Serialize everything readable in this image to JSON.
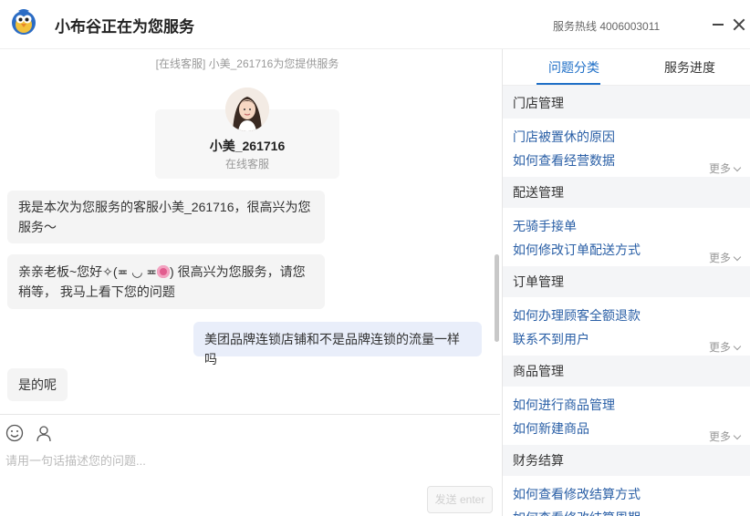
{
  "header": {
    "title": "小布谷正在为您服务",
    "hotline": "服务热线 4006003011"
  },
  "chat": {
    "system_line": "[在线客服] 小美_261716为您提供服务",
    "agent": {
      "name": "小美_261716",
      "role": "在线客服"
    },
    "messages": [
      {
        "from": "agent",
        "line1": "我是本次为您服务的客服小美_261716，很高兴为您",
        "line2": "服务～"
      },
      {
        "from": "agent",
        "line1_pre": "亲亲老板~您好✧(≖ ◡ ≖",
        "line1_post": ") 很高兴为您服务，请您",
        "line2": "稍等， 我马上看下您的问题"
      },
      {
        "from": "user",
        "text": "美团品牌连锁店铺和不是品牌连锁的流量一样吗"
      },
      {
        "from": "agent",
        "text": "是的呢"
      }
    ]
  },
  "input": {
    "placeholder": "请用一句话描述您的问题...",
    "send_label": "发送 enter"
  },
  "sidebar": {
    "tabs": [
      {
        "label": "问题分类",
        "active": true
      },
      {
        "label": "服务进度",
        "active": false
      }
    ],
    "more_label": "更多",
    "sections": [
      {
        "title": "门店管理",
        "links": [
          "门店被置休的原因",
          "如何查看经营数据"
        ]
      },
      {
        "title": "配送管理",
        "links": [
          "无骑手接单",
          "如何修改订单配送方式"
        ]
      },
      {
        "title": "订单管理",
        "links": [
          "如何办理顾客全额退款",
          "联系不到用户"
        ]
      },
      {
        "title": "商品管理",
        "links": [
          "如何进行商品管理",
          "如何新建商品"
        ]
      },
      {
        "title": "财务结算",
        "links": [
          "如何查看修改结算方式",
          "如何查看修改结算周期"
        ]
      }
    ]
  },
  "colors": {
    "accent": "#1f6fc7",
    "link": "#2a5fa6",
    "user_bubble": "#e9eefa",
    "agent_bubble": "#f4f4f4"
  }
}
